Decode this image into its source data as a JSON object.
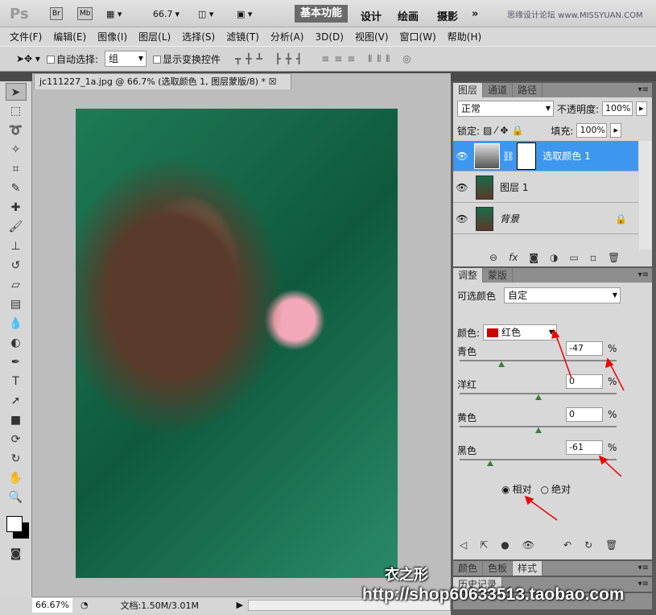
{
  "titlebar": {
    "ps": "Ps",
    "br": "Br",
    "mb": "Mb",
    "zoom": "66.7",
    "workspaces": [
      "基本功能",
      "设计",
      "绘画",
      "摄影"
    ],
    "more": "»",
    "brand": "思缘设计论坛 www.MISSYUAN.COM"
  },
  "menu": [
    "文件(F)",
    "编辑(E)",
    "图像(I)",
    "图层(L)",
    "选择(S)",
    "滤镜(T)",
    "分析(A)",
    "3D(D)",
    "视图(V)",
    "窗口(W)",
    "帮助(H)"
  ],
  "options": {
    "auto_select": "自动选择:",
    "auto_select_value": "组",
    "show_transform": "显示变换控件"
  },
  "document": {
    "tab": "jc111227_1a.jpg @ 66.7% (选取颜色 1, 图层蒙版/8) *",
    "zoom": "66.67%",
    "doc_size": "文档:1.50M/3.01M"
  },
  "layers": {
    "tabs": [
      "图层",
      "通道",
      "路径"
    ],
    "blend": "正常",
    "opacity_label": "不透明度:",
    "opacity": "100%",
    "lock_label": "锁定:",
    "fill_label": "填充:",
    "fill": "100%",
    "items": [
      {
        "name": "选取颜色 1",
        "selected": true
      },
      {
        "name": "图层 1"
      },
      {
        "name": "背景",
        "locked": true
      }
    ]
  },
  "adjust": {
    "tabs": [
      "调整",
      "蒙版"
    ],
    "title": "可选颜色",
    "preset": "自定",
    "color_label": "颜色:",
    "color_value": "红色",
    "color_swatch": "#cc0000",
    "sliders": [
      {
        "label": "青色",
        "value": "-47",
        "num": -47
      },
      {
        "label": "洋红",
        "value": "0",
        "num": 0
      },
      {
        "label": "黄色",
        "value": "0",
        "num": 0
      },
      {
        "label": "黑色",
        "value": "-61",
        "num": -61
      }
    ],
    "pct": "%",
    "relative": "相对",
    "absolute": "绝对"
  },
  "bottom_tabs": [
    "颜色",
    "色板",
    "样式"
  ],
  "history_tab": "历史记录",
  "watermark": {
    "name": "衣之形",
    "url": "http://shop60633513.taobao.com"
  }
}
